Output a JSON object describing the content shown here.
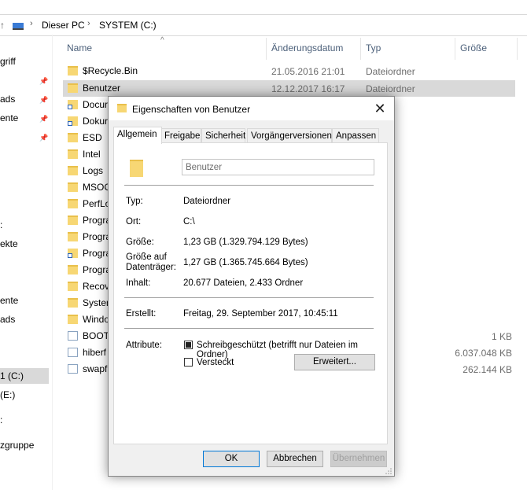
{
  "breadcrumb": {
    "items": [
      "Dieser PC",
      "SYSTEM (C:)"
    ]
  },
  "sidebar": {
    "items": [
      {
        "label": "griff",
        "pinned": false
      },
      {
        "label": "",
        "pinned": true
      },
      {
        "label": "ads",
        "pinned": true
      },
      {
        "label": "ente",
        "pinned": true
      },
      {
        "label": "",
        "pinned": true
      },
      {
        "label": "",
        "pinned": false
      },
      {
        "label": ":",
        "pinned": false
      },
      {
        "label": "ekte",
        "pinned": false
      },
      {
        "label": "",
        "pinned": false
      },
      {
        "label": "ente",
        "pinned": false
      },
      {
        "label": "ads",
        "pinned": false
      },
      {
        "label": "1 (C:)",
        "pinned": false
      },
      {
        "label": "(E:)",
        "pinned": false
      },
      {
        "label": ":",
        "pinned": false
      },
      {
        "label": "zgruppe",
        "pinned": false
      }
    ]
  },
  "columns": {
    "name": "Name",
    "date": "Änderungsdatum",
    "type": "Typ",
    "size": "Größe"
  },
  "files": [
    {
      "name": "$Recycle.Bin",
      "date": "21.05.2016 21:01",
      "type": "Dateiordner",
      "size": "",
      "icon": "folder-icon"
    },
    {
      "name": "Benutzer",
      "date": "12.12.2017 16:17",
      "type": "Dateiordner",
      "size": "",
      "icon": "folder-icon"
    },
    {
      "name": "Docur",
      "date": "",
      "type": "dner",
      "size": "",
      "icon": "shortcut-folder-icon"
    },
    {
      "name": "Dokur",
      "date": "",
      "type": "dner",
      "size": "",
      "icon": "shortcut-folder-icon"
    },
    {
      "name": "ESD",
      "date": "",
      "type": "dner",
      "size": "",
      "icon": "folder-icon"
    },
    {
      "name": "Intel",
      "date": "",
      "type": "dner",
      "size": "",
      "icon": "folder-icon"
    },
    {
      "name": "Logs",
      "date": "",
      "type": "dner",
      "size": "",
      "icon": "folder-icon"
    },
    {
      "name": "MSOC",
      "date": "",
      "type": "dner",
      "size": "",
      "icon": "folder-icon"
    },
    {
      "name": "PerfLo",
      "date": "",
      "type": "dner",
      "size": "",
      "icon": "folder-icon"
    },
    {
      "name": "Progra",
      "date": "",
      "type": "dner",
      "size": "",
      "icon": "folder-icon"
    },
    {
      "name": "Progra",
      "date": "",
      "type": "dner",
      "size": "",
      "icon": "folder-icon"
    },
    {
      "name": "Progra",
      "date": "",
      "type": "dner",
      "size": "",
      "icon": "shortcut-folder-icon"
    },
    {
      "name": "Progra",
      "date": "",
      "type": "dner",
      "size": "",
      "icon": "folder-icon"
    },
    {
      "name": "Recov",
      "date": "",
      "type": "dner",
      "size": "",
      "icon": "folder-icon"
    },
    {
      "name": "Systen",
      "date": "",
      "type": "dner",
      "size": "",
      "icon": "folder-icon"
    },
    {
      "name": "Windo",
      "date": "",
      "type": "dner",
      "size": "",
      "icon": "folder-icon"
    },
    {
      "name": "BOOT",
      "date": "",
      "type": "atei",
      "size": "1 KB",
      "icon": "file-icon"
    },
    {
      "name": "hiberf",
      "date": "",
      "type": "atei",
      "size": "6.037.048 KB",
      "icon": "file-icon"
    },
    {
      "name": "swapf",
      "date": "",
      "type": "atei",
      "size": "262.144 KB",
      "icon": "file-icon"
    }
  ],
  "dialog": {
    "title": "Eigenschaften von Benutzer",
    "tabs": [
      "Allgemein",
      "Freigabe",
      "Sicherheit",
      "Vorgängerversionen",
      "Anpassen"
    ],
    "name_value": "Benutzer",
    "props": {
      "type_label": "Typ:",
      "type_value": "Dateiordner",
      "location_label": "Ort:",
      "location_value": "C:\\",
      "size_label": "Größe:",
      "size_value": "1,23 GB (1.329.794.129 Bytes)",
      "disk_label_1": "Größe auf",
      "disk_label_2": "Datenträger:",
      "disk_value": "1,27 GB (1.365.745.664 Bytes)",
      "contains_label": "Inhalt:",
      "contains_value": "20.677 Dateien, 2.433 Ordner",
      "created_label": "Erstellt:",
      "created_value": "Freitag, 29. September 2017, 10:45:11",
      "attributes_label": "Attribute:",
      "readonly_label": "Schreibgeschützt (betrifft nur Dateien im Ordner)",
      "hidden_label": "Versteckt",
      "advanced_button": "Erweitert..."
    },
    "buttons": {
      "ok": "OK",
      "cancel": "Abbrechen",
      "apply": "Übernehmen"
    }
  }
}
